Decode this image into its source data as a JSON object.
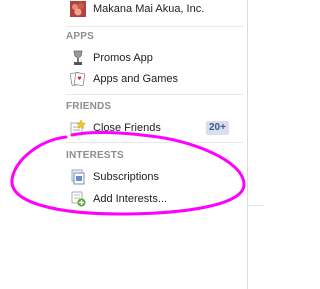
{
  "pages": {
    "label": "Makana Mai Akua, Inc."
  },
  "apps": {
    "header": "APPS",
    "items": [
      {
        "label": "Promos App",
        "icon": "promos-app-icon"
      },
      {
        "label": "Apps and Games",
        "icon": "apps-and-games-icon"
      }
    ]
  },
  "friends": {
    "header": "FRIENDS",
    "items": [
      {
        "label": "Close Friends",
        "icon": "close-friends-icon",
        "badge": "20+"
      }
    ]
  },
  "interests": {
    "header": "INTERESTS",
    "items": [
      {
        "label": "Subscriptions",
        "icon": "subscriptions-icon"
      },
      {
        "label": "Add Interests...",
        "icon": "add-interests-icon"
      }
    ]
  },
  "colors": {
    "annotation": "#ff00ff",
    "badge_bg": "#d8dfea",
    "badge_text": "#3b5998"
  }
}
